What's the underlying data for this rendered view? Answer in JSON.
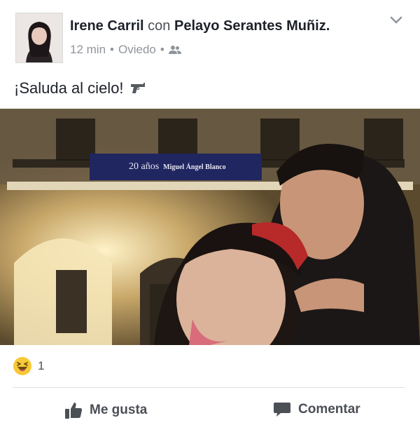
{
  "post": {
    "author": "Irene Carril",
    "with_word": "con",
    "tagged": "Pelayo Serantes Muñiz.",
    "time": "12 min",
    "separator": "•",
    "location": "Oviedo",
    "audience_icon": "friends-icon",
    "text": "¡Saluda al cielo!",
    "text_icon": "pistol-icon"
  },
  "photo": {
    "banner_text_1": "20 años",
    "banner_text_2": "Miguel Ángel Blanco"
  },
  "reactions": {
    "icon": "haha-icon",
    "count": "1"
  },
  "actions": {
    "like_label": "Me gusta",
    "comment_label": "Comentar"
  },
  "colors": {
    "text_primary": "#1d2129",
    "text_secondary": "#90949c",
    "action_gray": "#4b4f56",
    "haha_yellow": "#f7c937"
  }
}
